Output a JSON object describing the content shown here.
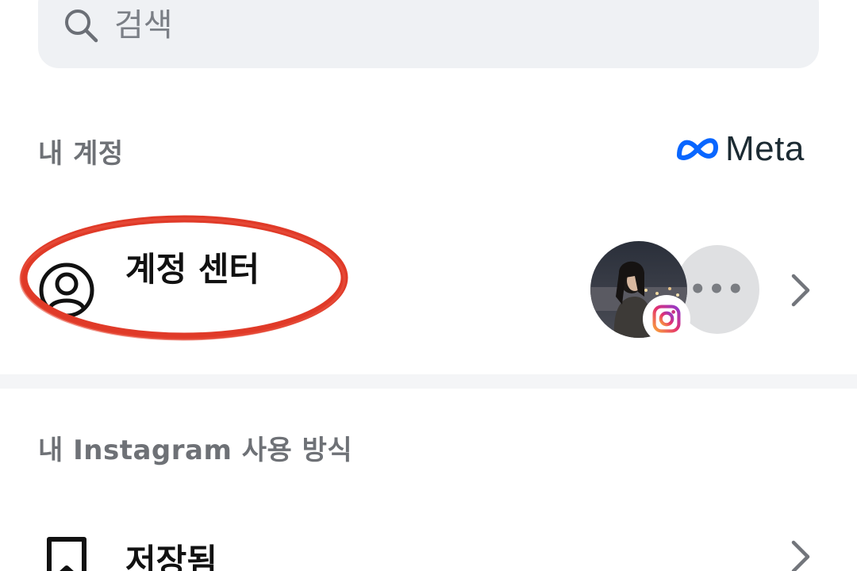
{
  "search": {
    "placeholder": "검색"
  },
  "my_account": {
    "section_title": "내 계정",
    "brand": "Meta",
    "account_center": {
      "label": "계정 센터",
      "more_icon": "more-horizontal-icon"
    }
  },
  "usage": {
    "section_title": "내 Instagram 사용 방식",
    "items": [
      {
        "label": "저장됨",
        "icon": "bookmark-icon"
      }
    ]
  },
  "colors": {
    "annotation": "#e03a28",
    "meta_blue": "#0866ff",
    "background": "#ffffff"
  }
}
